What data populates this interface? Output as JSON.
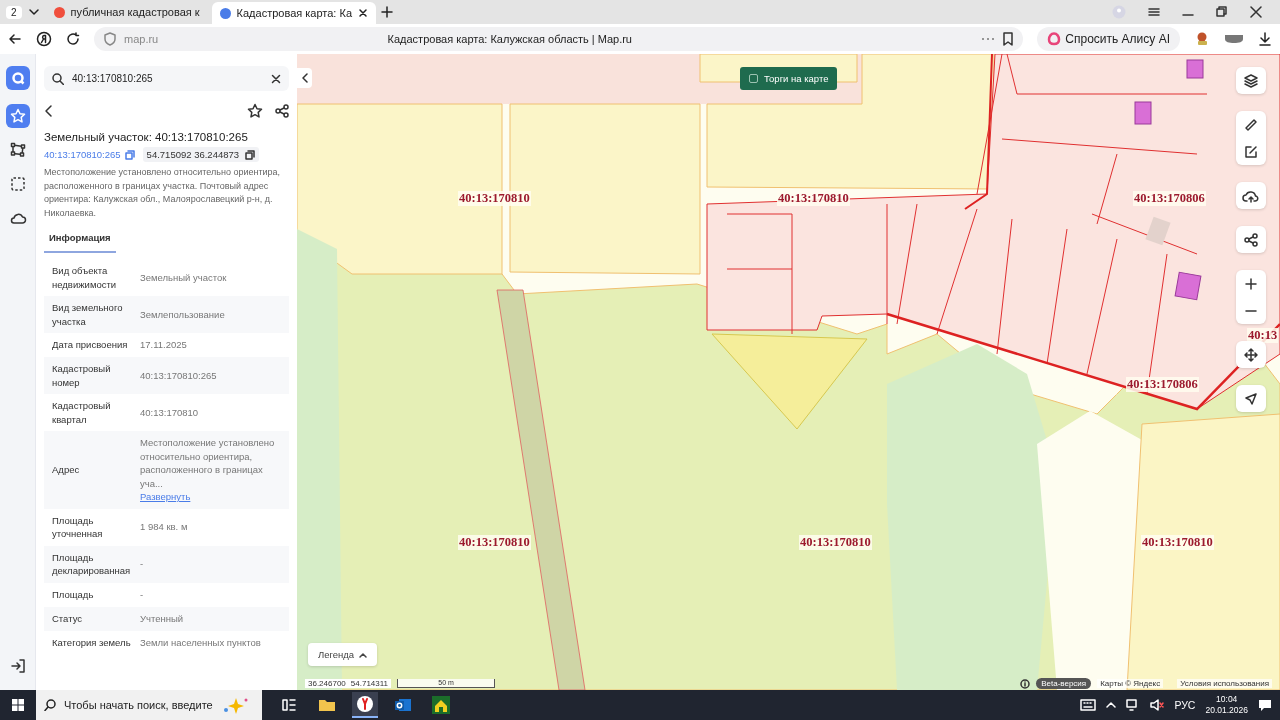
{
  "browser": {
    "tab_count": "2",
    "tabs": [
      {
        "title": "публичная кадастровая к",
        "selected": false
      },
      {
        "title": "Кадастровая карта: Ка",
        "selected": true
      }
    ],
    "url": "map.ru",
    "page_title": "Кадастровая карта: Калужская область | Map.ru",
    "alice_button": "Спросить Алису AI"
  },
  "rail": {
    "items": [
      {
        "kind": "star",
        "selected": true
      },
      {
        "kind": "polygon",
        "selected": false
      },
      {
        "kind": "frame",
        "selected": false
      },
      {
        "kind": "cloud",
        "selected": false
      }
    ]
  },
  "panel": {
    "search": {
      "value": "40:13:170810:265"
    },
    "title": "Земельный участок: 40:13:170810:265",
    "cadastral_number": "40:13:170810:265",
    "coordinates": "54.715092 36.244873",
    "description": "Местоположение установлено относительно ориентира, расположенного в границах участка. Почтовый адрес ориентира: Калужская обл., Малоярославецкий р-н, д. Николаевка.",
    "tabs": [
      {
        "label": "Информация",
        "selected": true
      }
    ],
    "properties": [
      {
        "label": "Вид объекта недвижимости",
        "value": "Земельный участок"
      },
      {
        "label": "Вид земельного участка",
        "value": "Землепользование"
      },
      {
        "label": "Дата присвоения",
        "value": "17.11.2025"
      },
      {
        "label": "Кадастровый номер",
        "value": "40:13:170810:265"
      },
      {
        "label": "Кадастровый квартал",
        "value": "40:13:170810"
      },
      {
        "label": "Адрес",
        "value": "Местоположение установлено относительно ориентира, расположенного в границах уча...",
        "link": "Развернуть"
      },
      {
        "label": "Площадь уточненная",
        "value": "1 984 кв. м"
      },
      {
        "label": "Площадь декларированная",
        "value": "-"
      },
      {
        "label": "Площадь",
        "value": "-"
      },
      {
        "label": "Статус",
        "value": "Учтенный"
      },
      {
        "label": "Категория земель",
        "value": "Земли населенных пунктов"
      }
    ]
  },
  "map": {
    "auction_toggle": {
      "label": "Торги на карте",
      "checked": false
    },
    "block_labels": [
      "40:13:170810",
      "40:13:170810",
      "40:13:170806",
      "40:13",
      "40:13:170806",
      "40:13:170810",
      "40:13:170810",
      "40:13:170810"
    ],
    "legend_button": "Легенда",
    "cursor_coordinates": [
      "36.246700",
      "54.714311"
    ],
    "scale": "50 m",
    "beta_badge": "Beta-версия",
    "attribution": "Карты © Яндекс",
    "terms_link": "Условия использования"
  },
  "taskbar": {
    "search_placeholder": "Чтобы начать поиск, введите",
    "language": "РУС",
    "time": "10:04",
    "date": "20.01.2026"
  }
}
